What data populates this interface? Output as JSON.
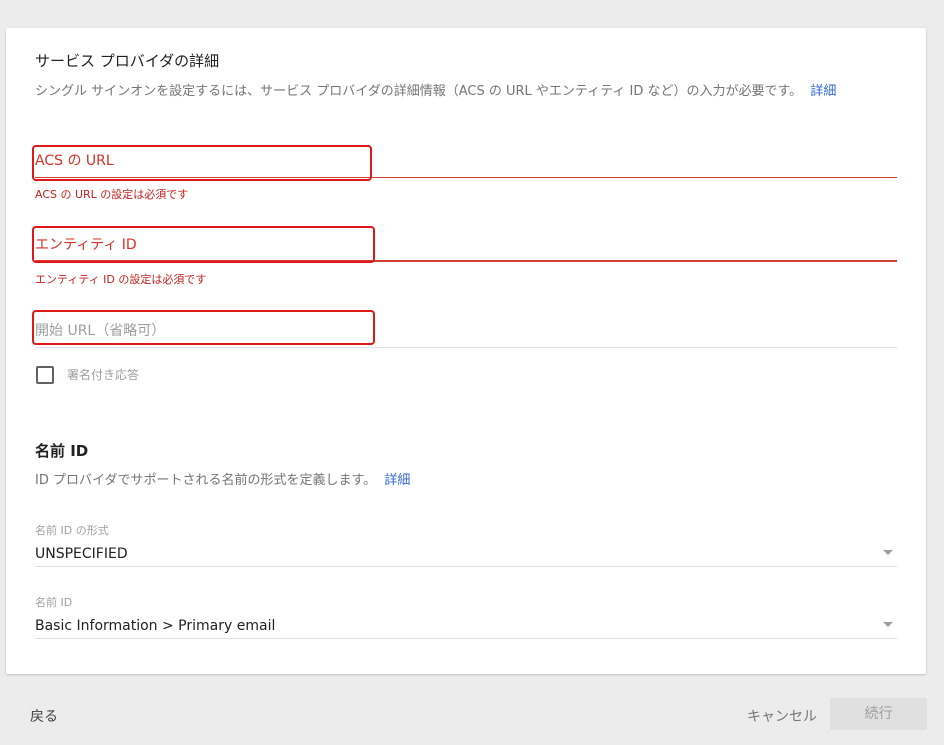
{
  "service_provider": {
    "title": "サービス プロバイダの詳細",
    "description": "シングル サインオンを設定するには、サービス プロバイダの詳細情報（ACS の URL やエンティティ ID など）の入力が必要です。",
    "details_link": "詳細"
  },
  "fields": {
    "acs_url": {
      "placeholder": "ACS の URL",
      "value": "",
      "error": "ACS の URL の設定は必須です"
    },
    "entity_id": {
      "placeholder": "エンティティ ID",
      "value": "",
      "error": "エンティティ ID の設定は必須です"
    },
    "start_url": {
      "placeholder": "開始 URL（省略可）",
      "value": ""
    }
  },
  "signed_response": {
    "label": "署名付き応答",
    "checked": false
  },
  "name_id": {
    "title": "名前 ID",
    "description": "ID プロバイダでサポートされる名前の形式を定義します。",
    "details_link": "詳細",
    "format": {
      "label": "名前 ID の形式",
      "value": "UNSPECIFIED"
    },
    "id": {
      "label": "名前 ID",
      "value": "Basic Information > Primary email"
    }
  },
  "footer": {
    "back_label": "戻る",
    "cancel_label": "キャンセル",
    "continue_label": "続行"
  },
  "colors": {
    "error": "#d23f31",
    "link": "#3367d6",
    "highlight": "#e01818"
  }
}
